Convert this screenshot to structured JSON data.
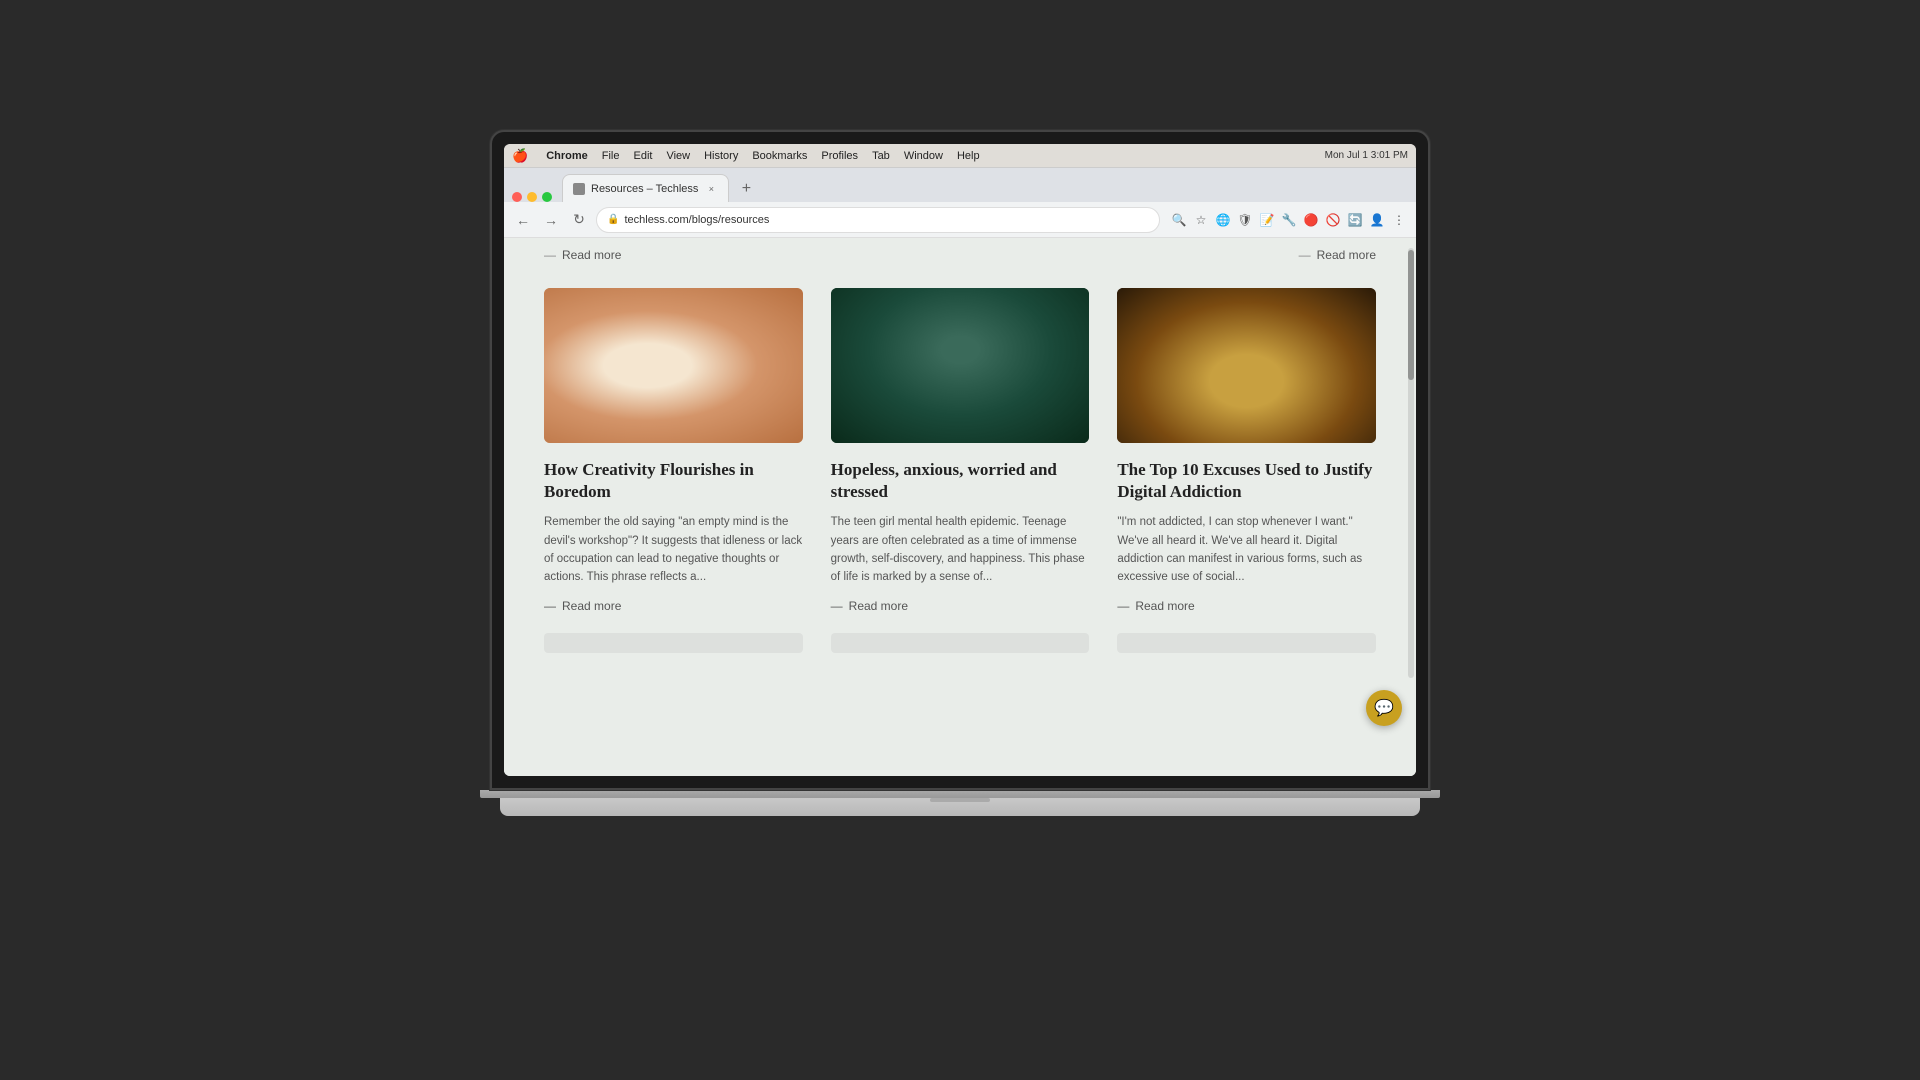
{
  "mac": {
    "menu_items": [
      "🍎",
      "Chrome",
      "File",
      "Edit",
      "View",
      "History",
      "Bookmarks",
      "Profiles",
      "Tab",
      "Window",
      "Help"
    ],
    "time": "Mon Jul 1  3:01 PM"
  },
  "browser": {
    "tab_title": "Resources – Techless",
    "tab_close": "×",
    "tab_new": "+",
    "url": "techless.com/blogs/resources",
    "nav_back": "←",
    "nav_forward": "→",
    "nav_refresh": "↻"
  },
  "page": {
    "top_readmore1": "Read more",
    "top_readmore2": "Read more",
    "articles": [
      {
        "id": "creativity",
        "title": "How Creativity Flourishes in Boredom",
        "excerpt": "Remember the old saying \"an empty mind is the devil's workshop\"? It suggests that idleness or lack of occupation can lead to negative thoughts or actions. This phrase reflects a...",
        "readmore": "Read more"
      },
      {
        "id": "hopeless",
        "title": "Hopeless, anxious, worried and stressed",
        "excerpt": "The teen girl mental health epidemic. Teenage years are often celebrated as a time of immense growth, self-discovery, and happiness. This phase of life is marked by a sense of...",
        "readmore": "Read more"
      },
      {
        "id": "addiction",
        "title": "The Top 10 Excuses Used to Justify Digital Addiction",
        "excerpt": "\"I'm not addicted, I can stop whenever I want.\" We've all heard it. We've all heard it. Digital addiction can manifest in various forms, such as excessive use of social...",
        "readmore": "Read more"
      }
    ],
    "fab_icon": "💬"
  }
}
